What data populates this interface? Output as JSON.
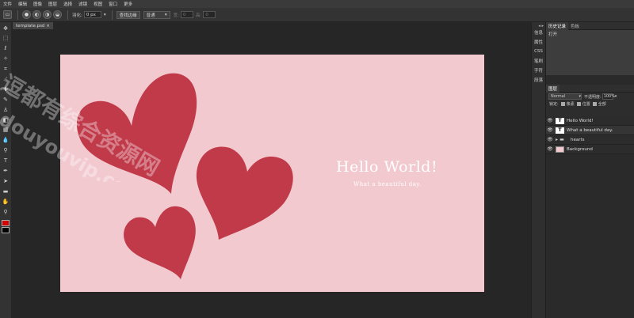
{
  "menubar": {
    "items": [
      "文件",
      "编辑",
      "图像",
      "图层",
      "选择",
      "滤镜",
      "视图",
      "窗口",
      "更多"
    ]
  },
  "options_bar": {
    "feather_label": "羽化:",
    "feather_value": "0",
    "feather_unit": "px",
    "refine_edge_button": "查找边缘",
    "mode_select": "普通",
    "width_label": "宽:",
    "width_value": "0",
    "height_label": "高:",
    "height_value": "0"
  },
  "document_tab": {
    "title": "template.psd",
    "close_glyph": "×"
  },
  "toolbar": {
    "foreground_color": "#d50000",
    "background_color": "#000000"
  },
  "canvas": {
    "background_color": "#f2c9cf",
    "heart_color": "#c03a4a",
    "hello_text": "Hello World!",
    "sub_text": "What a beautiful day."
  },
  "watermark": {
    "line1": "逗都有综合资源网",
    "line2": "douyouvip.com"
  },
  "side_icons": {
    "collapse_glyph": "◂ ▸",
    "items": [
      "信息",
      "属性",
      "CSS",
      "笔刷",
      "字符",
      "段落"
    ]
  },
  "history_panel": {
    "tabs": [
      "历史记录",
      "色板"
    ],
    "active_tab": 0,
    "items": [
      "打开"
    ]
  },
  "layers_panel": {
    "tab": "图层",
    "blend_mode": "Normal",
    "opacity_label": "不透明度:",
    "opacity_value": "100%",
    "lock_label": "锁定:",
    "lock_options": [
      "像素",
      "位置",
      "全部"
    ],
    "layers": [
      {
        "name": "Hello World!",
        "type": "text"
      },
      {
        "name": "What a beautiful day.",
        "type": "text"
      },
      {
        "name": "hearts",
        "type": "folder"
      },
      {
        "name": "Background",
        "type": "image"
      }
    ]
  }
}
